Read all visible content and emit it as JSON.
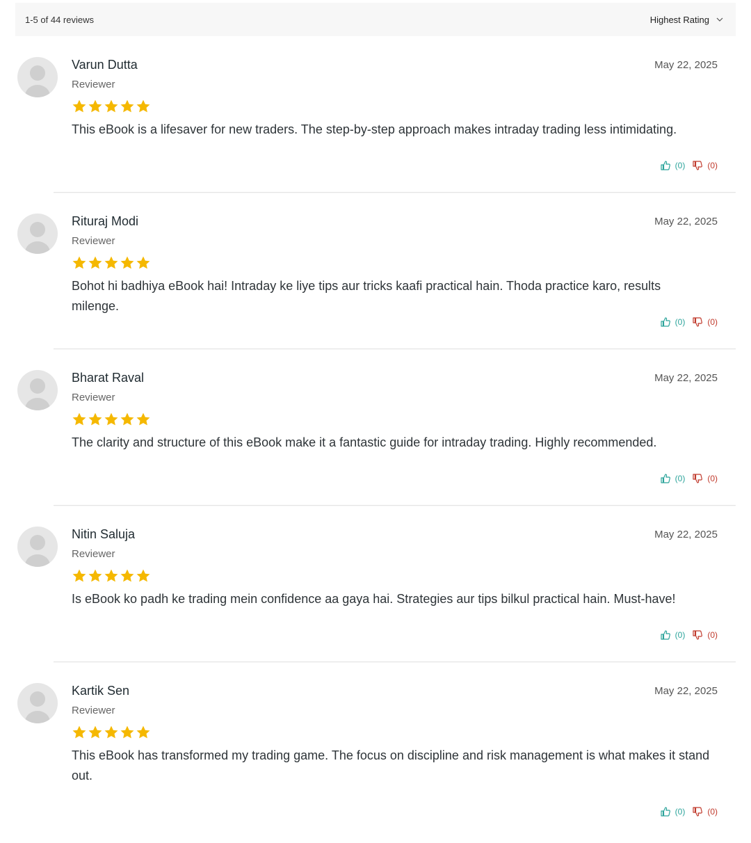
{
  "summary": {
    "count_text": "1-5 of 44 reviews",
    "sort_label": "Highest Rating"
  },
  "colors": {
    "star": "#f5b800",
    "upvote": "#2aa39a",
    "downvote": "#c0392b"
  },
  "reviews": [
    {
      "name": "Varun Dutta",
      "role": "Reviewer",
      "date": "May 22, 2025",
      "rating": 5,
      "text": "This eBook is a lifesaver for new traders. The step-by-step approach makes intraday trading less intimidating.",
      "likes": "(0)",
      "dislikes": "(0)"
    },
    {
      "name": "Rituraj Modi",
      "role": "Reviewer",
      "date": "May 22, 2025",
      "rating": 5,
      "text": "Bohot hi badhiya eBook hai! Intraday ke liye tips aur tricks kaafi practical hain. Thoda practice karo, results milenge.",
      "likes": "(0)",
      "dislikes": "(0)"
    },
    {
      "name": "Bharat Raval",
      "role": "Reviewer",
      "date": "May 22, 2025",
      "rating": 5,
      "text": "The clarity and structure of this eBook make it a fantastic guide for intraday trading. Highly recommended.",
      "likes": "(0)",
      "dislikes": "(0)"
    },
    {
      "name": "Nitin Saluja",
      "role": "Reviewer",
      "date": "May 22, 2025",
      "rating": 5,
      "text": "Is eBook ko padh ke trading mein confidence aa gaya hai. Strategies aur tips bilkul practical hain. Must-have!",
      "likes": "(0)",
      "dislikes": "(0)"
    },
    {
      "name": "Kartik Sen",
      "role": "Reviewer",
      "date": "May 22, 2025",
      "rating": 5,
      "text": "This eBook has transformed my trading game. The focus on discipline and risk management is what makes it stand out.",
      "likes": "(0)",
      "dislikes": "(0)"
    }
  ]
}
